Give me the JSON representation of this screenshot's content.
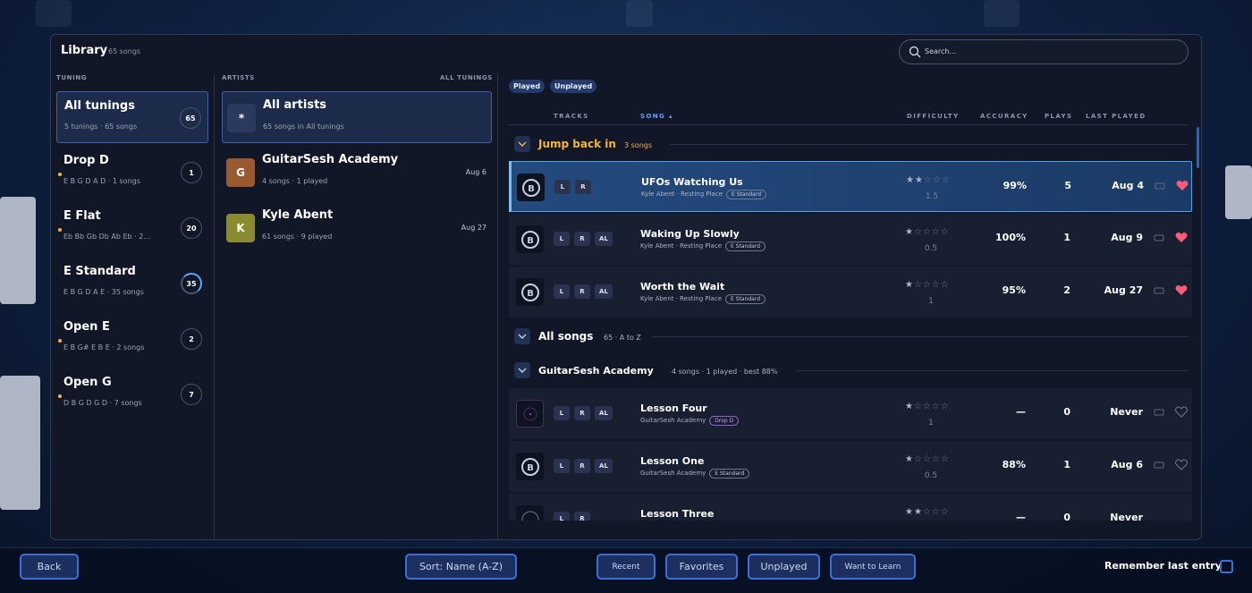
{
  "library": {
    "title": "Library",
    "count": "65 songs"
  },
  "search": {
    "placeholder": "Search..."
  },
  "tuning_column": {
    "header": "TUNING"
  },
  "artists_column": {
    "header": "ARTISTS",
    "filter": "ALL TUNINGS"
  },
  "tunings": [
    {
      "name": "All tunings",
      "sub": "5 tunings · 65 songs",
      "count": "65",
      "active": true
    },
    {
      "name": "Drop D",
      "sub": "E B G D A D · 1 songs",
      "count": "1"
    },
    {
      "name": "E Flat",
      "sub": "Eb Bb Gb Db Ab Eb · 2…",
      "count": "20"
    },
    {
      "name": "E Standard",
      "sub": "E B G D A E · 35 songs",
      "count": "35"
    },
    {
      "name": "Open E",
      "sub": "E B G# E B E · 2 songs",
      "count": "2"
    },
    {
      "name": "Open G",
      "sub": "D B G D G D · 7 songs",
      "count": "7"
    }
  ],
  "artists": [
    {
      "avatar": "*",
      "name": "All artists",
      "sub": "65 songs in All tunings",
      "date": "",
      "color": "#2a3a5e",
      "active": true
    },
    {
      "avatar": "G",
      "name": "GuitarSesh Academy",
      "sub": "4 songs · 1 played",
      "date": "Aug 6",
      "color": "#9a5a30"
    },
    {
      "avatar": "K",
      "name": "Kyle Abent",
      "sub": "61 songs · 9 played",
      "date": "Aug 27",
      "color": "#8a8a2e"
    }
  ],
  "filters": {
    "played": "Played",
    "unplayed": "Unplayed"
  },
  "song_headers": {
    "tracks": "TRACKS",
    "song": "SONG ▴",
    "difficulty": "DIFFICULTY",
    "accuracy": "ACCURACY",
    "plays": "PLAYS",
    "last_played": "LAST PLAYED"
  },
  "groups": {
    "jump": {
      "title": "Jump back in",
      "sub": "3 songs"
    },
    "all": {
      "title": "All songs",
      "sub": "65 · A to Z"
    },
    "gsa": {
      "title": "GuitarSesh Academy",
      "sub": "4 songs · 1 played · best 88%"
    }
  },
  "songs": [
    {
      "title": "UFOs Watching Us",
      "artist": "Kyle Abent · Resting Place",
      "tuning": "E Standard",
      "tracks": [
        "L",
        "R"
      ],
      "stars": 1.5,
      "difficulty": "1.5",
      "accuracy": "99%",
      "plays": "5",
      "last": "Aug 4",
      "favorite": true,
      "selected": true
    },
    {
      "title": "Waking Up Slowly",
      "artist": "Kyle Abent · Resting Place",
      "tuning": "E Standard",
      "tracks": [
        "L",
        "R",
        "AL"
      ],
      "stars": 0.5,
      "difficulty": "0.5",
      "accuracy": "100%",
      "plays": "1",
      "last": "Aug 9",
      "favorite": true
    },
    {
      "title": "Worth the Wait",
      "artist": "Kyle Abent · Resting Place",
      "tuning": "E Standard",
      "tracks": [
        "L",
        "R",
        "AL"
      ],
      "stars": 1,
      "difficulty": "1",
      "accuracy": "95%",
      "plays": "2",
      "last": "Aug 27",
      "favorite": true
    },
    {
      "title": "Lesson Four",
      "artist": "GuitarSesh Academy",
      "tuning": "Drop D",
      "tracks": [
        "L",
        "R",
        "AL"
      ],
      "stars": 1,
      "difficulty": "1",
      "accuracy": "—",
      "plays": "0",
      "last": "Never",
      "favorite": false
    },
    {
      "title": "Lesson One",
      "artist": "GuitarSesh Academy",
      "tuning": "E Standard",
      "tracks": [
        "L",
        "R",
        "AL"
      ],
      "stars": 0.5,
      "difficulty": "0.5",
      "accuracy": "88%",
      "plays": "1",
      "last": "Aug 6",
      "favorite": false
    },
    {
      "title": "Lesson Three",
      "artist": "",
      "tuning": "",
      "tracks": [
        "L",
        "R"
      ],
      "stars": 1.5,
      "difficulty": "",
      "accuracy": "—",
      "plays": "0",
      "last": "Never",
      "favorite": false
    }
  ],
  "bottom": {
    "back": "Back",
    "sort": "Sort: Name (A-Z)",
    "recent": "Recent",
    "favorites": "Favorites",
    "unplayed": "Unplayed",
    "want_to_learn": "Want to Learn",
    "remember": "Remember last entry"
  },
  "colors": {
    "accent": "#3d6ed8",
    "gold": "#f2b63a",
    "heart": "#ff5a7a",
    "selected_border": "#4aa3ea"
  },
  "icons": {
    "search": "search-icon",
    "chevron": "chevron-down-icon",
    "trophy": "trophy-icon",
    "heart": "heart-icon",
    "song_badge": "difficulty-badge-icon"
  }
}
